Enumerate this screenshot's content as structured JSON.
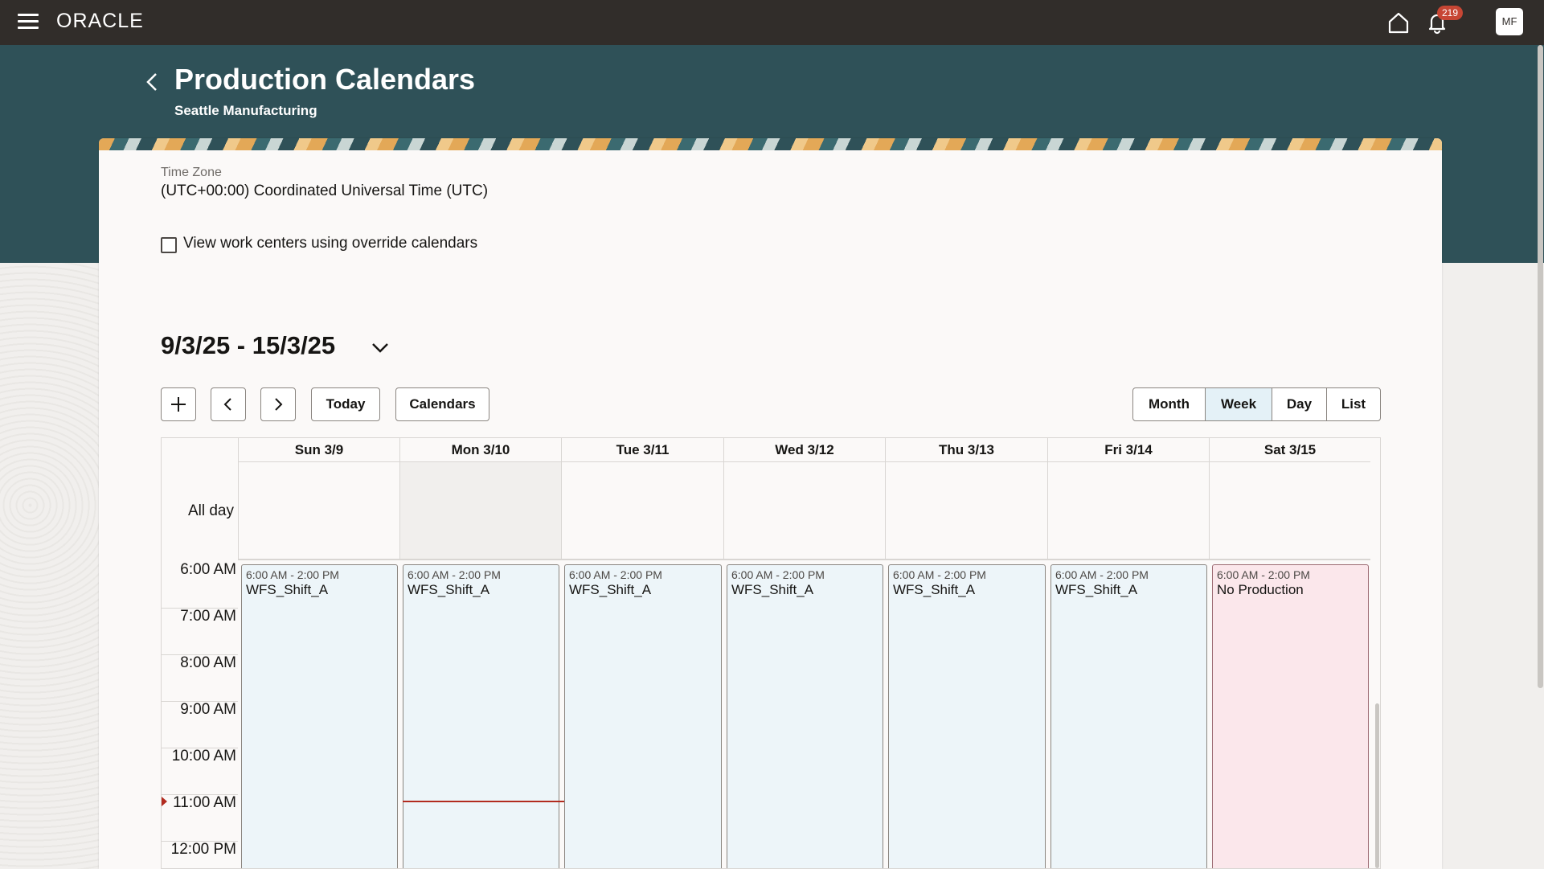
{
  "app": {
    "logo": "ORACLE",
    "notification_count": "219",
    "user_initials": "MF"
  },
  "page": {
    "title": "Production Calendars",
    "subtitle": "Seattle Manufacturing"
  },
  "timezone": {
    "label": "Time Zone",
    "value": "(UTC+00:00) Coordinated Universal Time (UTC)"
  },
  "override_checkbox": {
    "label": "View work centers using override calendars",
    "checked": false
  },
  "calendar": {
    "range": "9/3/25 - 15/3/25",
    "toolbar": {
      "today": "Today",
      "calendars": "Calendars"
    },
    "views": [
      "Month",
      "Week",
      "Day",
      "List"
    ],
    "selected_view": "Week",
    "allday_label": "All day",
    "days": [
      {
        "label": "Sun 3/9",
        "event_time": "6:00 AM - 2:00 PM",
        "event_title": "WFS_Shift_A"
      },
      {
        "label": "Mon 3/10",
        "event_time": "6:00 AM - 2:00 PM",
        "event_title": "WFS_Shift_A"
      },
      {
        "label": "Tue 3/11",
        "event_time": "6:00 AM - 2:00 PM",
        "event_title": "WFS_Shift_A"
      },
      {
        "label": "Wed 3/12",
        "event_time": "6:00 AM - 2:00 PM",
        "event_title": "WFS_Shift_A"
      },
      {
        "label": "Thu 3/13",
        "event_time": "6:00 AM - 2:00 PM",
        "event_title": "WFS_Shift_A"
      },
      {
        "label": "Fri 3/14",
        "event_time": "6:00 AM - 2:00 PM",
        "event_title": "WFS_Shift_A"
      },
      {
        "label": "Sat 3/15",
        "event_time": "6:00 AM - 2:00 PM",
        "event_title": "No Production"
      }
    ],
    "hours": [
      "6:00 AM",
      "7:00 AM",
      "8:00 AM",
      "9:00 AM",
      "10:00 AM",
      "11:00 AM",
      "12:00 PM"
    ]
  },
  "colors": {
    "topbar": "#312d2a",
    "header_band": "#2f5158",
    "event_bg": "#edf5f9",
    "no_production_bg": "#fbe7eb",
    "badge": "#c74634",
    "now_line": "#b22b1f"
  }
}
